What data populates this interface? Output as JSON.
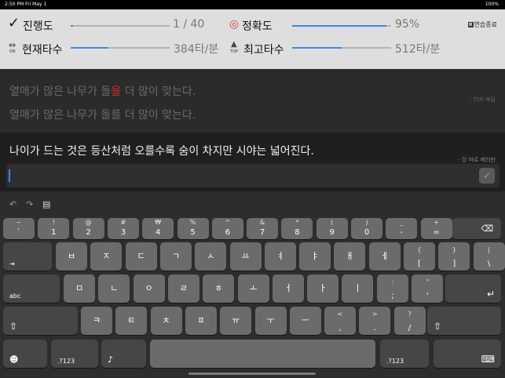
{
  "status": {
    "time_date": "2:50 PM   Fri May 1",
    "battery": "100%"
  },
  "stats": {
    "progress": {
      "icon": "✓",
      "label": "진행도",
      "value": "1 / 40",
      "fraction": 0.025
    },
    "accuracy": {
      "icon": "◎",
      "label": "정확도",
      "value": "95%",
      "fraction": 0.95
    },
    "current_speed": {
      "icon": "⇔",
      "sub": "ON",
      "label": "현재타수",
      "value": "384타/분",
      "fraction": 0.37
    },
    "top_speed": {
      "icon": "▲",
      "sub": "TOP",
      "label": "최고타수",
      "value": "512타/분",
      "fraction": 0.5
    },
    "end_button": {
      "icon": "⊠",
      "label": "연습종료"
    }
  },
  "prev_sentence": {
    "typed_before": "열매가 많은 나무가 돌",
    "typed_error": "을",
    "typed_after": " 더 많이 맞는다.",
    "original": "열매가 많은 나무가 돌를 더 많이 맞는다.",
    "author": "- 터키 속담"
  },
  "current_sentence": {
    "text": "나이가 드는 것은 등산처럼 오를수록 숨이 차지만 시야는 넓어진다.",
    "author": "- 잉 마르 베리만",
    "input_value": "",
    "check_icon": "✓"
  },
  "keyboard": {
    "toolbar": {
      "undo": "↶",
      "redo": "↷",
      "paste": "▤"
    },
    "row1": [
      [
        "~",
        "`"
      ],
      [
        "!",
        "1"
      ],
      [
        "@",
        "2"
      ],
      [
        "#",
        "3"
      ],
      [
        "₩",
        "4"
      ],
      [
        "%",
        "5"
      ],
      [
        "^",
        "6"
      ],
      [
        "&",
        "7"
      ],
      [
        "*",
        "8"
      ],
      [
        "(",
        "9"
      ],
      [
        ")",
        "0"
      ],
      [
        "_",
        "-"
      ],
      [
        "+",
        "="
      ]
    ],
    "delete": "⌫",
    "tab": "⇥",
    "row2": [
      "ㅂ",
      "ㅈ",
      "ㄷ",
      "ㄱ",
      "ㅅ",
      "ㅛ",
      "ㅕ",
      "ㅑ",
      "ㅐ",
      "ㅔ"
    ],
    "row2_sym": [
      [
        "{",
        "["
      ],
      [
        "}",
        "]"
      ],
      [
        "|",
        "\\"
      ]
    ],
    "abc": "abc",
    "row3": [
      "ㅁ",
      "ㄴ",
      "ㅇ",
      "ㄹ",
      "ㅎ",
      "ㅗ",
      "ㅓ",
      "ㅏ",
      "ㅣ"
    ],
    "row3_sym": [
      [
        ":",
        ";"
      ],
      [
        "\"",
        "'"
      ]
    ],
    "return": "↵",
    "shift": "⇧",
    "row4": [
      "ㅋ",
      "ㅌ",
      "ㅊ",
      "ㅍ",
      "ㅠ",
      "ㅜ",
      "ㅡ"
    ],
    "row4_sym": [
      [
        "<",
        ","
      ],
      [
        ">",
        "."
      ],
      [
        "?",
        "/"
      ]
    ],
    "emoji": "☻",
    "num_left": ".?123",
    "mic": "♪",
    "num_right": ".?123",
    "kb_hide": "⌨"
  }
}
